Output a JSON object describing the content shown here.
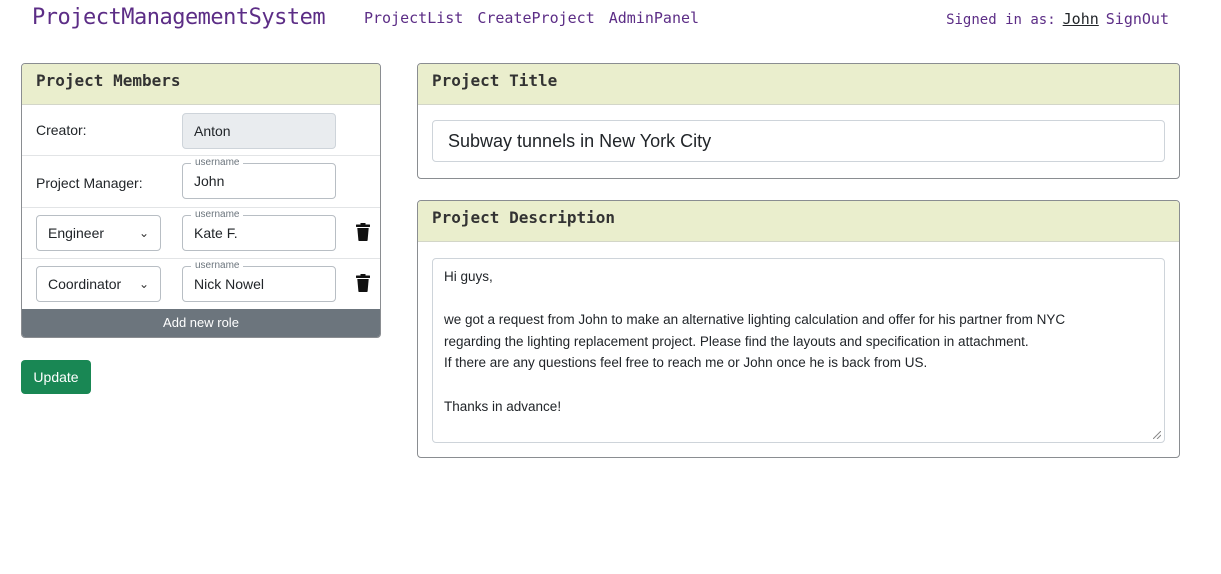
{
  "header": {
    "brand": "ProjectManagementSystem",
    "nav": [
      "ProjectList",
      "CreateProject",
      "AdminPanel"
    ],
    "signed_in_label": "Signed in as:",
    "username": "John",
    "signout": "SignOut"
  },
  "members": {
    "title": "Project Members",
    "creator_label": "Creator:",
    "creator_value": "Anton",
    "pm_label": "Project Manager:",
    "float_label": "username",
    "pm_value": "John",
    "roles": [
      {
        "role": "Engineer",
        "username": "Kate F."
      },
      {
        "role": "Coordinator",
        "username": "Nick Nowel"
      }
    ],
    "add_role": "Add new role"
  },
  "update_label": "Update",
  "title_card": {
    "header": "Project Title",
    "value": "Subway tunnels in New York City"
  },
  "desc_card": {
    "header": "Project Description",
    "lines": [
      "Hi guys,",
      "",
      "we got a request from John to make an alternative lighting calculation and offer for his partner from NYC",
      "regarding the lighting replacement project. Please find the layouts and specification in attachment.",
      "If there are any questions feel free to reach me or John once he is back from US.",
      "",
      "Thanks in advance!"
    ]
  },
  "colors": {
    "brand": "#5c2d86",
    "card_header_bg": "#eaeecd",
    "update_button": "#198754",
    "add_role_button": "#6c757d"
  }
}
